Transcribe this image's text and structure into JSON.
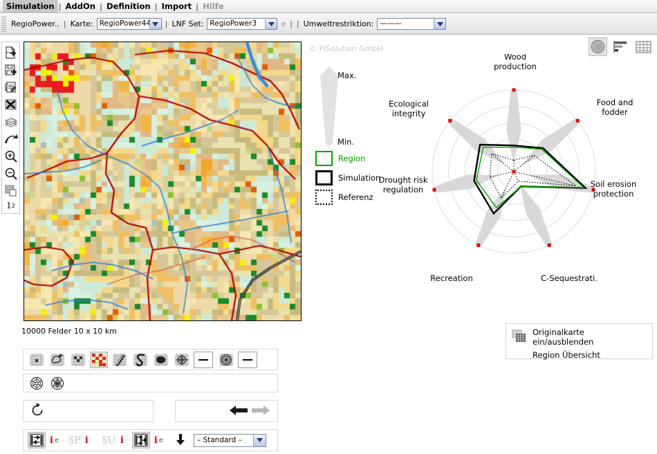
{
  "menubar": {
    "items": [
      {
        "label": "Simulation",
        "state": "active"
      },
      {
        "label": "AddOn",
        "state": "normal"
      },
      {
        "label": "Definition",
        "state": "normal"
      },
      {
        "label": "Import",
        "state": "normal"
      },
      {
        "label": "Hilfe",
        "state": "disabled"
      }
    ],
    "separator": "|"
  },
  "toolstrip": {
    "app_label": "RegioPower..",
    "sep": "|",
    "karte_label": "Karte:",
    "karte_value": "RegioPower44::",
    "lnf_label": "LNF Set:",
    "lnf_value": "RegioPower3",
    "e_label": "e",
    "umwelt_label": "Umweltrestriktion:",
    "umwelt_value": "———"
  },
  "left_tools": [
    {
      "name": "export-page-icon"
    },
    {
      "name": "save-disk-icon"
    },
    {
      "name": "print-icon"
    },
    {
      "name": "delete-grid-icon"
    },
    {
      "name": "layers-icon"
    },
    {
      "name": "undo-arrow-icon"
    },
    {
      "name": "zoom-in-icon"
    },
    {
      "name": "zoom-out-icon"
    },
    {
      "name": "grid-copy-icon"
    },
    {
      "name": "one-squared-label",
      "label": "1"
    }
  ],
  "map": {
    "copyright": "© PiSolution GmbH",
    "info": "10000 Felder   10 x 10 km",
    "cells": 10000,
    "extent": "10 x 10 km"
  },
  "right_tools": [
    {
      "name": "radar-view-icon",
      "selected": true
    },
    {
      "name": "bar-chart-view-icon",
      "selected": false
    },
    {
      "name": "table-view-icon",
      "selected": false
    }
  ],
  "chart_legend": {
    "max_label": "Max.",
    "min_label": "Min.",
    "entries": [
      {
        "label": "Region",
        "color": "#00a000",
        "style": "solid-thin"
      },
      {
        "label": "Simulation",
        "color": "#000000",
        "style": "solid-thick"
      },
      {
        "label": "Referenz",
        "color": "#000000",
        "style": "dotted"
      }
    ]
  },
  "chart_data": {
    "type": "radar",
    "title": "",
    "categories": [
      "Wood production",
      "Food and fodder",
      "Soil erosion protection",
      "C-Sequestrati.",
      "Recreation",
      "Drought risk regulation",
      "Ecological integrity"
    ],
    "rlim": [
      0,
      1
    ],
    "grid": true,
    "grid_rings": [
      0.2,
      0.4,
      0.6,
      0.8,
      1.0
    ],
    "axis_marker_color": "#dd0000",
    "band_color": "#d8d8d8",
    "legend_position": "left",
    "series": [
      {
        "name": "Region",
        "color": "#00a000",
        "style": "solid-thin",
        "values": [
          0.3,
          0.44,
          0.88,
          0.2,
          0.49,
          0.47,
          0.48
        ]
      },
      {
        "name": "Simulation",
        "color": "#000000",
        "style": "solid-thick",
        "values": [
          0.32,
          0.46,
          0.9,
          0.2,
          0.57,
          0.5,
          0.53
        ]
      },
      {
        "name": "Referenz",
        "color": "#000000",
        "style": "dotted",
        "values": [
          0.14,
          0.32,
          0.78,
          0.13,
          0.36,
          0.3,
          0.35
        ]
      }
    ],
    "bands": [
      {
        "axis": "Wood production",
        "min": 0.1,
        "max": 1.0,
        "halfwidth": 0.09
      },
      {
        "axis": "Food and fodder",
        "min": 0.12,
        "max": 1.0,
        "halfwidth": 0.09
      },
      {
        "axis": "Soil erosion protection",
        "min": 0.18,
        "max": 1.0,
        "halfwidth": 0.09
      },
      {
        "axis": "C-Sequestrati.",
        "min": 0.16,
        "max": 1.0,
        "halfwidth": 0.09
      },
      {
        "axis": "Recreation",
        "min": 0.22,
        "max": 1.0,
        "halfwidth": 0.09
      },
      {
        "axis": "Drought risk regulation",
        "min": 0.2,
        "max": 1.0,
        "halfwidth": 0.09
      },
      {
        "axis": "Ecological integrity",
        "min": 0.14,
        "max": 1.0,
        "halfwidth": 0.09
      }
    ]
  },
  "right_panel": {
    "line1": "Originalkarte ein/ausblenden",
    "line2": "Region Übersicht",
    "icon": "map-layers-icon"
  },
  "bottom_toolbar_1": [
    {
      "name": "single-cell-tool",
      "selected": false
    },
    {
      "name": "lasso-tool",
      "selected": false
    },
    {
      "name": "multi-cell-tool",
      "selected": false
    },
    {
      "name": "paint-grid-tool",
      "selected": true
    },
    {
      "name": "line-tool",
      "selected": false
    },
    {
      "name": "freehand-tool",
      "selected": false
    },
    {
      "name": "blob-fill-tool",
      "selected": false
    },
    {
      "name": "crosshair-target-tool",
      "selected": false
    },
    {
      "name": "crosshair-color-swatch",
      "swatch": true
    },
    {
      "name": "concentric-target-tool",
      "selected": false
    },
    {
      "name": "concentric-color-swatch",
      "swatch": true
    }
  ],
  "bottom_toolbar_2": [
    {
      "name": "wheel-spokes-tool"
    },
    {
      "name": "wheel-star-tool"
    }
  ],
  "bottom_toolbar_3": [
    {
      "name": "reset-rotate-icon"
    }
  ],
  "bottom_toolbar_4": [
    {
      "name": "back-arrow-icon",
      "enabled": true
    },
    {
      "name": "forward-arrow-icon",
      "enabled": false
    }
  ],
  "bottom_toolbar_5": {
    "items": [
      {
        "name": "transfer-right-icon",
        "selected": true,
        "i": "i",
        "e": "e"
      },
      {
        "name": "paragraph-p-icon",
        "glyph": "§P",
        "i": "i"
      },
      {
        "name": "paragraph-u-icon",
        "glyph": "§U",
        "i": "i"
      },
      {
        "name": "transfer-both-icon",
        "selected": true,
        "i": "i",
        "e": "e"
      },
      {
        "name": "download-arrow-icon"
      }
    ],
    "preset_value": "– Standard –"
  }
}
